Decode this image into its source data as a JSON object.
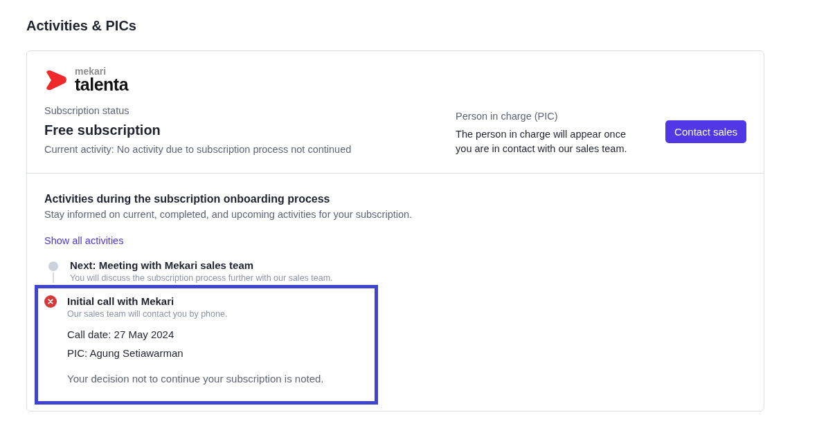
{
  "page_title": "Activities & PICs",
  "logo": {
    "brand": "mekari",
    "product": "talenta"
  },
  "subscription": {
    "label": "Subscription status",
    "value": "Free subscription",
    "activity": "Current activity: No activity due to subscription process not continued"
  },
  "pic": {
    "label": "Person in charge (PIC)",
    "text": "The person in charge will appear once you are in contact with our sales team.",
    "button": "Contact sales"
  },
  "activities": {
    "title": "Activities during the subscription onboarding process",
    "subtitle": "Stay informed on current, completed, and upcoming activities for your subscription.",
    "link": "Show all activities",
    "steps": [
      {
        "kind": "upcoming",
        "title": "Next: Meeting with Mekari sales team",
        "description": "You will discuss the subscription process further with our sales team.",
        "highlighted": false
      },
      {
        "kind": "cancelled",
        "title": "Initial call with Mekari",
        "description": "Our sales team will contact you by phone.",
        "details": [
          "Call date: 27 May 2024",
          "PIC: Agung Setiawarman"
        ],
        "note": "Your decision not to continue your subscription is noted.",
        "highlighted": true
      }
    ]
  }
}
